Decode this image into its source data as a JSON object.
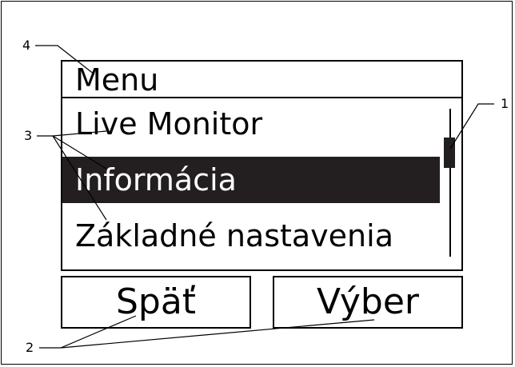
{
  "display": {
    "title": "Menu",
    "items": [
      "Live Monitor",
      "Informácia",
      "Základné nastavenia"
    ],
    "selected_index": 1,
    "softkeys": {
      "left": "Späť",
      "right": "Výber"
    }
  },
  "callouts": [
    "1",
    "2",
    "3",
    "4"
  ],
  "colors": {
    "selected_bg": "#231f20",
    "selected_fg": "#ffffff"
  }
}
